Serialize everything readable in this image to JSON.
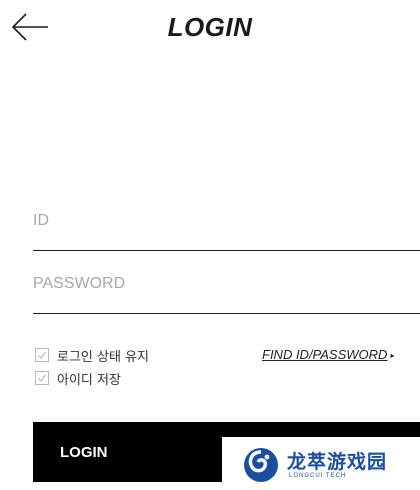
{
  "header": {
    "title": "LOGIN",
    "back_icon": "arrow-left-icon"
  },
  "form": {
    "id_placeholder": "ID",
    "id_value": "",
    "password_placeholder": "PASSWORD",
    "password_value": ""
  },
  "options": {
    "keep_login_label": "로그인 상태 유지",
    "keep_login_checked": true,
    "save_id_label": "아이디 저장",
    "save_id_checked": true,
    "find_link_label": "FIND ID/PASSWORD",
    "find_link_icon": "caret-right-icon"
  },
  "login_button": {
    "label": "LOGIN"
  },
  "watermark": {
    "text": "龙萃游戏园",
    "subtext": "LONGCUI TECH"
  },
  "colors": {
    "button_bg": "#000000",
    "text": "#222222",
    "placeholder": "#a8a8a8",
    "checkbox_border": "#b9b9b9",
    "watermark_blue": "#1a4fa0"
  }
}
